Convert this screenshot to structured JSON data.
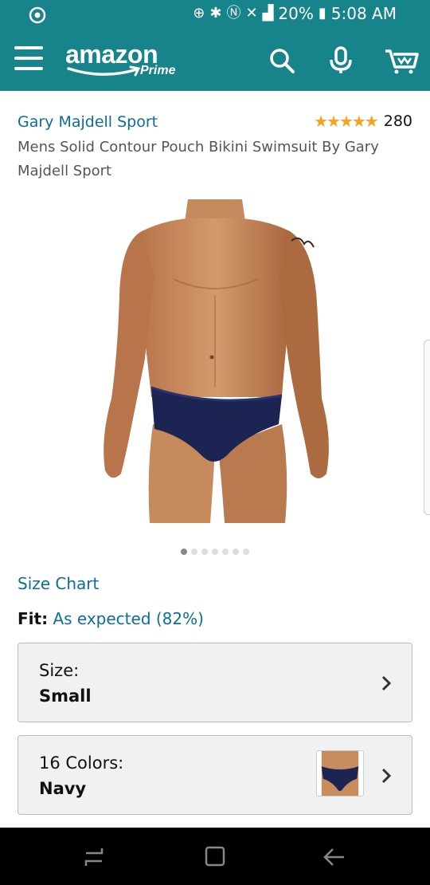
{
  "status_bar": {
    "battery": "20%",
    "time": "5:08 AM"
  },
  "header": {
    "logo_text": "amazon",
    "logo_sub": "Prime",
    "icons": [
      "menu-icon",
      "search-icon",
      "microphone-icon",
      "cart-icon"
    ]
  },
  "product": {
    "brand": "Gary Majdell Sport",
    "rating_stars": 4.5,
    "rating_count": "280",
    "title": "Mens Solid Contour Pouch Bikini Swimsuit By Gary Majdell Sport",
    "image_count": 7,
    "active_image": 1
  },
  "size_chart_link": "Size Chart",
  "fit": {
    "label": "Fit:",
    "value": "As expected (82%)"
  },
  "size_selector": {
    "label": "Size:",
    "value": "Small"
  },
  "color_selector": {
    "label": "16 Colors:",
    "value": "Navy"
  },
  "colors": {
    "header_bg": "#17838a",
    "link": "#0b6d99",
    "star": "#f4a41c",
    "swimsuit": "#1c2454"
  }
}
